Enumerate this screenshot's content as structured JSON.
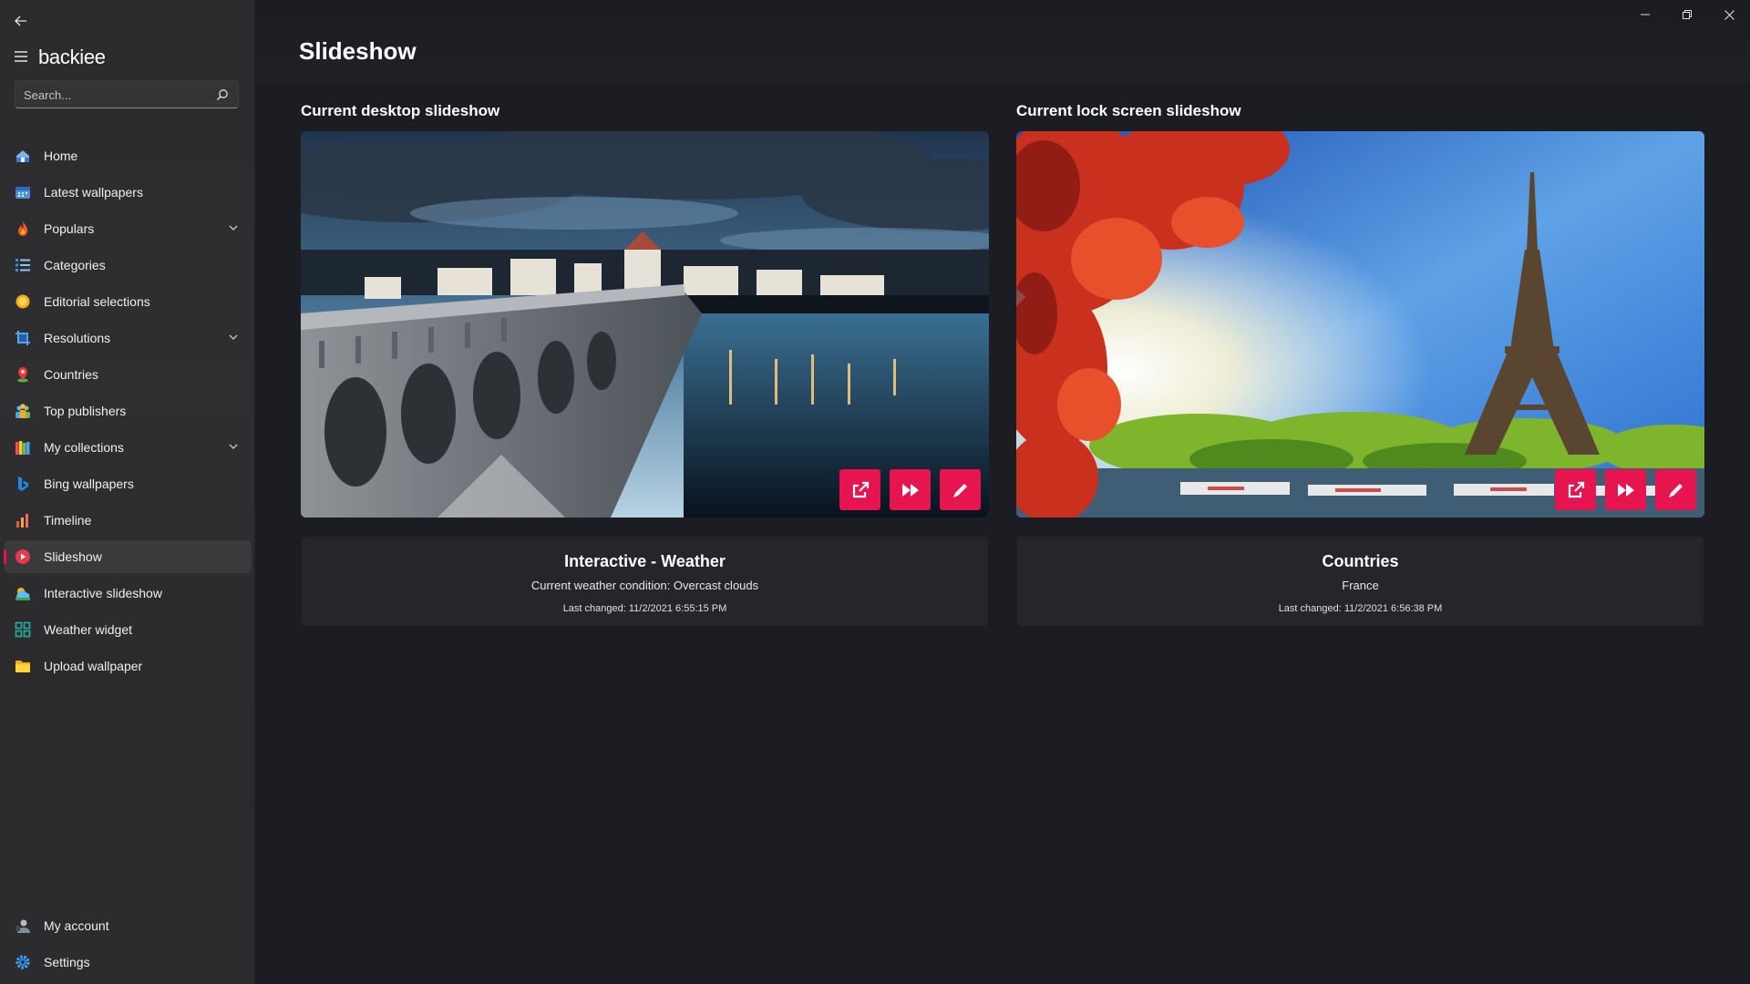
{
  "app": {
    "name": "backiee"
  },
  "search": {
    "placeholder": "Search..."
  },
  "nav": {
    "items": [
      {
        "label": "Home",
        "icon": "home-icon"
      },
      {
        "label": "Latest wallpapers",
        "icon": "calendar-icon"
      },
      {
        "label": "Populars",
        "icon": "flame-icon",
        "expandable": true
      },
      {
        "label": "Categories",
        "icon": "list-icon"
      },
      {
        "label": "Editorial selections",
        "icon": "sun-icon"
      },
      {
        "label": "Resolutions",
        "icon": "crop-icon",
        "expandable": true
      },
      {
        "label": "Countries",
        "icon": "location-pin-icon"
      },
      {
        "label": "Top publishers",
        "icon": "people-icon"
      },
      {
        "label": "My collections",
        "icon": "books-icon",
        "expandable": true
      },
      {
        "label": "Bing wallpapers",
        "icon": "bing-icon"
      },
      {
        "label": "Timeline",
        "icon": "bar-chart-icon"
      },
      {
        "label": "Slideshow",
        "icon": "play-circle-icon",
        "active": true
      },
      {
        "label": "Interactive slideshow",
        "icon": "weather-icon"
      },
      {
        "label": "Weather widget",
        "icon": "widget-grid-icon"
      },
      {
        "label": "Upload wallpaper",
        "icon": "folder-icon"
      }
    ],
    "bottom": [
      {
        "label": "My account",
        "icon": "user-icon"
      },
      {
        "label": "Settings",
        "icon": "gear-icon"
      }
    ]
  },
  "page": {
    "title": "Slideshow"
  },
  "desktop": {
    "section_title": "Current desktop slideshow",
    "card_title": "Interactive - Weather",
    "card_subtitle": "Current weather condition: Overcast clouds",
    "last_changed": "Last changed: 11/2/2021 6:55:15 PM"
  },
  "lockscreen": {
    "section_title": "Current lock screen slideshow",
    "card_title": "Countries",
    "card_subtitle": "France",
    "last_changed": "Last changed: 11/2/2021 6:56:38 PM"
  },
  "colors": {
    "accent": "#e6154f",
    "background": "#1c1d22",
    "sidebar": "#2c2c2e"
  }
}
